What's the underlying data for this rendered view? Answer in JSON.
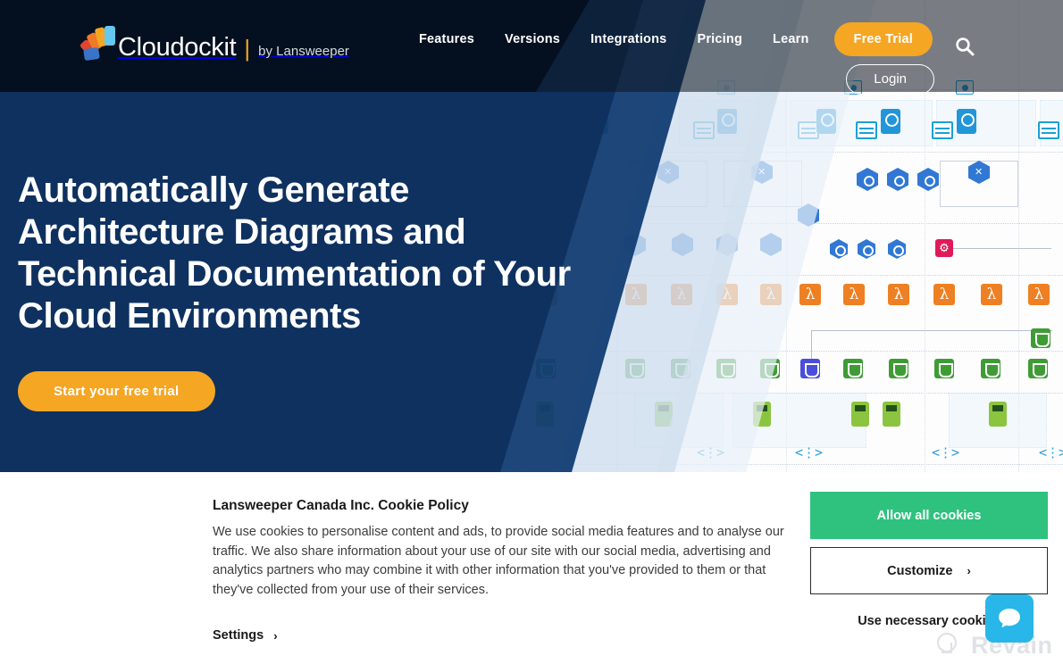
{
  "brand": {
    "name": "Cloudockit",
    "separator": "|",
    "byline": "by Lansweeper",
    "logo_icon": "cloudockit-fan-logo",
    "colors": {
      "orange": "#f5a623",
      "header_navy": "#04101f",
      "hero_navy": "#0e3160",
      "green": "#2ec27e",
      "chat_blue": "#29b6e8"
    }
  },
  "header": {
    "nav": [
      {
        "label": "Features",
        "name": "nav-features"
      },
      {
        "label": "Versions",
        "name": "nav-versions"
      },
      {
        "label": "Integrations",
        "name": "nav-integrations"
      },
      {
        "label": "Pricing",
        "name": "nav-pricing"
      },
      {
        "label": "Learn",
        "name": "nav-learn"
      }
    ],
    "free_trial_label": "Free Trial",
    "login_label": "Login",
    "search_icon": "search-icon"
  },
  "hero": {
    "title": "Automatically Generate Architecture Diagrams and Technical Documentation of Your Cloud Environments",
    "cta_label": "Start your free trial",
    "background_alt": "cloud-architecture-diagram"
  },
  "cookie_banner": {
    "title": "Lansweeper Canada Inc. Cookie Policy",
    "body": "We use cookies to personalise content and ads, to provide social media features and to analyse our traffic. We also share information about your use of our site with our social media, advertising and analytics partners who may combine it with other information that you've provided to them or that they've collected from your use of their services.",
    "settings_label": "Settings",
    "settings_chevron": "›",
    "allow_label": "Allow all cookies",
    "customize_label": "Customize",
    "customize_chevron": "›",
    "necessary_label": "Use necessary cookies"
  },
  "chat": {
    "icon": "chat-bubble-icon"
  },
  "watermark": {
    "text": "Revain",
    "icon": "revain-logo-icon"
  }
}
